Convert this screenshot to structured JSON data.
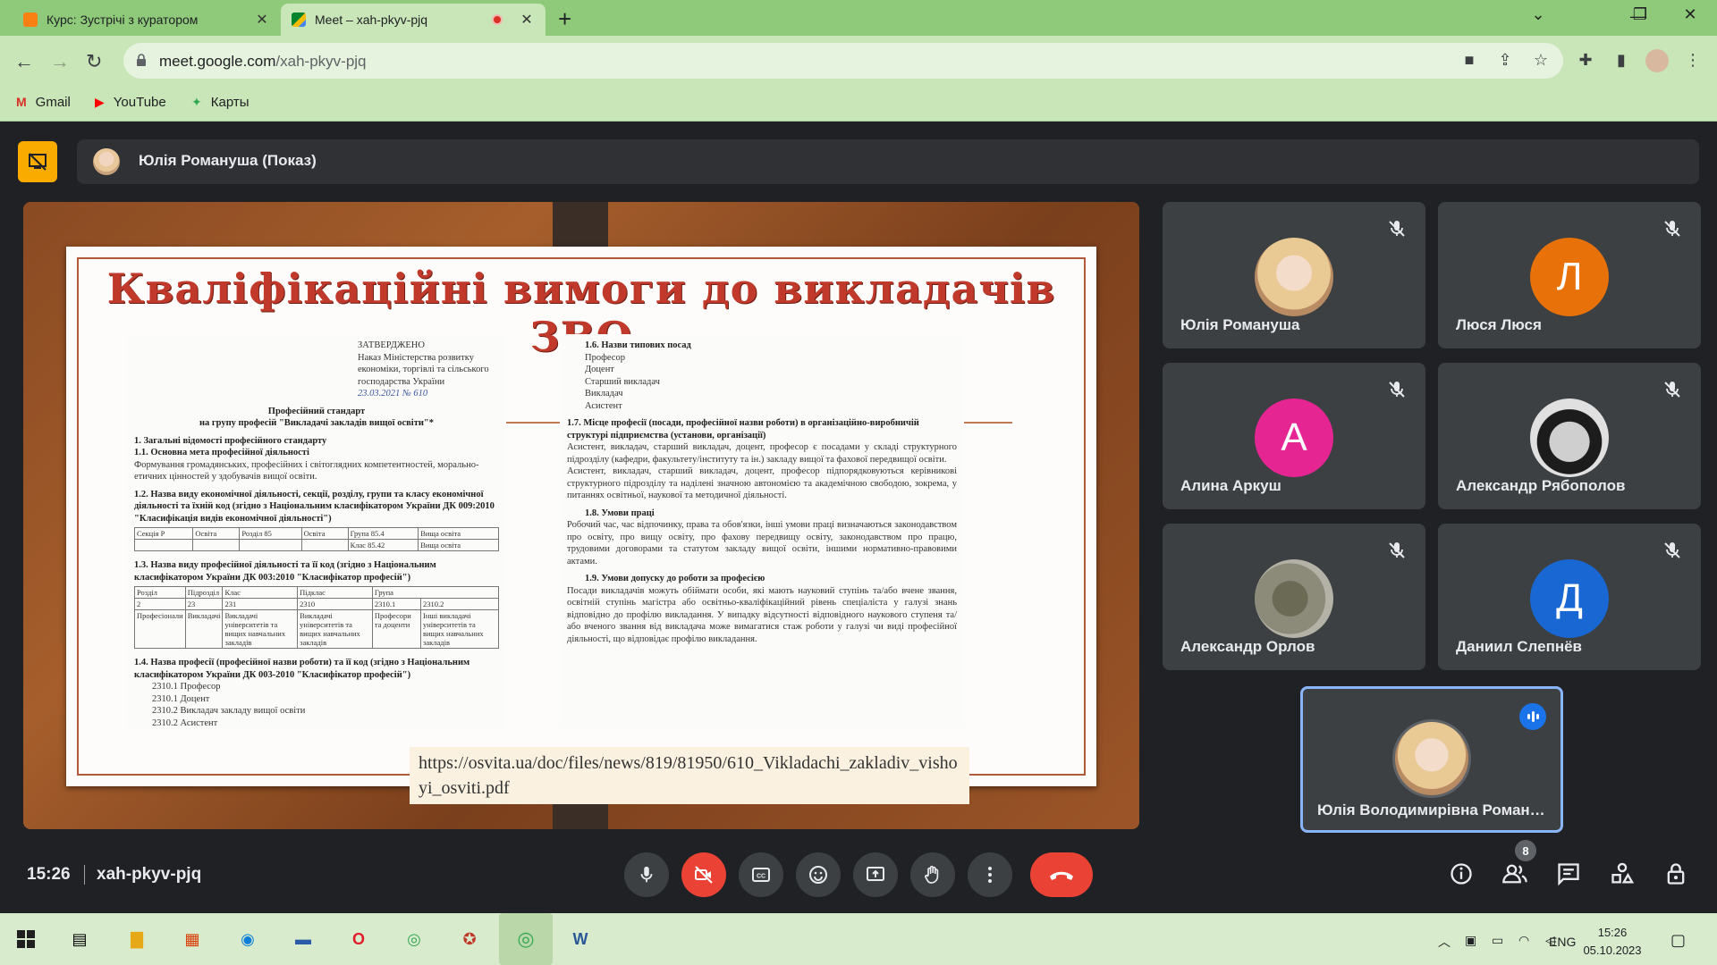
{
  "browser": {
    "tabs": [
      {
        "title": "Курс: Зустрічі з куратором",
        "active": false
      },
      {
        "title": "Meet – xah-pkyv-pjq",
        "active": true
      }
    ],
    "url_host": "meet.google.com",
    "url_path": "/xah-pkyv-pjq",
    "bookmarks": [
      "Gmail",
      "YouTube",
      "Карты"
    ]
  },
  "meet": {
    "presenter_label": "Юлія Романуша (Показ)",
    "slide": {
      "title": "Кваліфікаційні вимоги до викладачів ЗВО",
      "left_doc": {
        "approved": "ЗАТВЕРДЖЕНО",
        "order_lines": [
          "Наказ Міністерства розвитку",
          "економіки, торгівлі та сільського",
          "господарства України",
          "23.03.2021 № 610"
        ],
        "heading1": "Професійний стандарт",
        "heading2": "на групу професій \"Викладачі закладів вищої освіти\"*",
        "s1": "1. Загальні відомості професійного стандарту",
        "s11": "1.1. Основна мета професійної діяльності",
        "s11_text": "Формування громадянських, професійних і світоглядних компетентностей, морально-етичних цінностей у здобувачів вищої освіти.",
        "s12": "1.2. Назва виду економічної діяльності, секції, розділу, групи та класу економічної діяльності та їхній код (згідно з Національним класифікатором України ДК 009:2010 \"Класифікація видів економічної діяльності\")",
        "t1": [
          [
            "Секція Р",
            "Освіта",
            "Розділ 85",
            "Освіта",
            "Група 85.4",
            "Вища освіта"
          ],
          [
            "",
            "",
            "",
            "",
            "Клас 85.42",
            "Вища освіта"
          ]
        ],
        "s13": "1.3. Назва виду професійної діяльності та її код (згідно з Національним класифікатором України ДК 003:2010 \"Класифікатор професій\")",
        "t2_head": [
          "Розділ",
          "Підрозділ",
          "Клас",
          "Підклас",
          "Група"
        ],
        "t2_codes": [
          "2",
          "23",
          "231",
          "2310",
          "2310.1",
          "2310.2"
        ],
        "t2_row": [
          "Професіонали",
          "Викладачі",
          "Викладачі університетів та вищих навчальних закладів",
          "Викладачі університетів та вищих навчальних закладів",
          "Професори та доценти",
          "Інші викладачі університетів та вищих навчальних закладів"
        ],
        "s14": "1.4. Назва професії (професійної назви роботи) та її код (згідно з Національним класифікатором України ДК 003-2010 \"Класифікатор професій\")",
        "s14_items": [
          "2310.1 Професор",
          "2310.1 Доцент",
          "2310.2 Викладач закладу вищої освіти",
          "2310.2 Асистент"
        ]
      },
      "right_doc": {
        "s16": "1.6. Назви типових посад",
        "s16_items": [
          "Професор",
          "Доцент",
          "Старший викладач",
          "Викладач",
          "Асистент"
        ],
        "s17": "1.7. Місце професії (посади, професійної назви роботи) в організаційно-виробничій структурі підприємства (установи, організації)",
        "s17_p1": "Асистент, викладач, старший викладач, доцент, професор є посадами у складі структурного підрозділу (кафедри, факультету/інституту та ін.) закладу вищої та фахової передвищої освіти.",
        "s17_p2": "Асистент, викладач, старший викладач, доцент, професор підпорядковуються керівникові структурного підрозділу та наділені значною автономією та академічною свободою, зокрема, у питаннях освітньої, наукової та методичної діяльності.",
        "s18": "1.8. Умови праці",
        "s18_text": "Робочий час, час відпочинку, права та обов'язки, інші умови праці визначаються законодавством про освіту, про вищу освіту, про фахову передвищу освіту, законодавством про працю, трудовими договорами та статутом закладу вищої освіти, іншими нормативно-правовими актами.",
        "s19": "1.9. Умови допуску до роботи за професією",
        "s19_text": "Посади викладачів можуть обіймати особи, які мають науковий ступінь та/або вчене звання, освітній ступінь магістра або освітньо-кваліфікаційний рівень спеціаліста у галузі знань відповідно до профілю викладання. У випадку відсутності відповідного наукового ступеня та/або вченого звання від викладача може вимагатися стаж роботи у галузі чи виді професійної діяльності, що відповідає профілю викладання."
      },
      "link": "https://osvita.ua/doc/files/news/819/81950/610_Vikladachi_zakladiv_vishoyi_osviti.pdf"
    },
    "participants": [
      {
        "name": "Юлія Романуша",
        "initial": "",
        "color": "",
        "muted": true
      },
      {
        "name": "Люся Люся",
        "initial": "Л",
        "color": "#e8710a",
        "muted": true
      },
      {
        "name": "Алина Аркуш",
        "initial": "А",
        "color": "#e52592",
        "muted": true
      },
      {
        "name": "Александр Рябополов",
        "initial": "",
        "color": "",
        "muted": true
      },
      {
        "name": "Александр Орлов",
        "initial": "",
        "color": "",
        "muted": true
      },
      {
        "name": "Даниил Слепнёв",
        "initial": "Д",
        "color": "#1967d2",
        "muted": true
      },
      {
        "name": "Юлія Володимирівна Романуша",
        "initial": "",
        "color": "",
        "muted": false
      }
    ],
    "time": "15:26",
    "meeting_code": "xah-pkyv-pjq",
    "people_count": "8"
  },
  "taskbar": {
    "lang": "ENG",
    "time": "15:26",
    "date": "05.10.2023"
  }
}
